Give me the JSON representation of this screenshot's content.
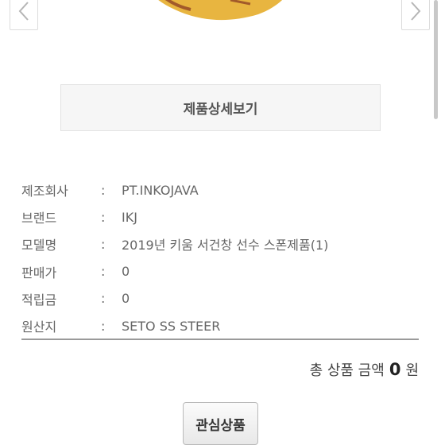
{
  "gallery": {
    "prev_icon": "chevron-left-icon",
    "next_icon": "chevron-right-icon",
    "image": "baseball-glove"
  },
  "detail_button_label": "제품상세보기",
  "specs": [
    {
      "label": "제조회사",
      "sep": ":",
      "value": "PT.INKOJAVA"
    },
    {
      "label": "브랜드",
      "sep": ":",
      "value": "IKJ"
    },
    {
      "label": "모델명",
      "sep": ":",
      "value": "2019년 키움 서건창 선수 스폰제품(1)"
    },
    {
      "label": "판매가",
      "sep": ":",
      "value": "0"
    },
    {
      "label": "적립금",
      "sep": ":",
      "value": "0"
    },
    {
      "label": "원산지",
      "sep": ":",
      "value": "SETO SS STEER"
    }
  ],
  "total": {
    "prefix": "총 상품 금액",
    "amount": "0",
    "unit": "원"
  },
  "wish_button_label": "관심상품",
  "colors": {
    "glove": "#E8B540",
    "glove_lace": "#A25A2A"
  }
}
